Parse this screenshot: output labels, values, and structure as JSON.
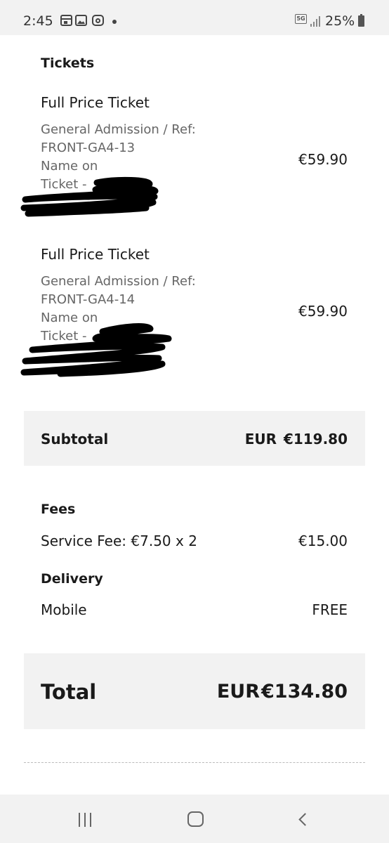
{
  "status_bar": {
    "time": "2:45",
    "network": "5G",
    "battery": "25%"
  },
  "order": {
    "tickets_heading": "Tickets",
    "tickets": [
      {
        "title": "Full Price Ticket",
        "description": "General Admission / Ref:\nFRONT-GA4-13\nName on\nTicket -",
        "price": "€59.90"
      },
      {
        "title": "Full Price Ticket",
        "description": "General Admission / Ref:\nFRONT-GA4-14\nName on\nTicket -",
        "price": "€59.90"
      }
    ],
    "subtotal": {
      "label": "Subtotal",
      "currency": "EUR",
      "amount": "€119.80"
    },
    "fees": {
      "heading": "Fees",
      "label": "Service Fee: €7.50 x 2",
      "value": "€15.00"
    },
    "delivery": {
      "heading": "Delivery",
      "label": "Mobile",
      "value": "FREE"
    },
    "total": {
      "label": "Total",
      "currency": "EUR",
      "amount": "€134.80"
    }
  },
  "nav_bar": {
    "recents_icon": "recents-icon",
    "home_icon": "home-icon",
    "back_icon": "back-icon"
  }
}
